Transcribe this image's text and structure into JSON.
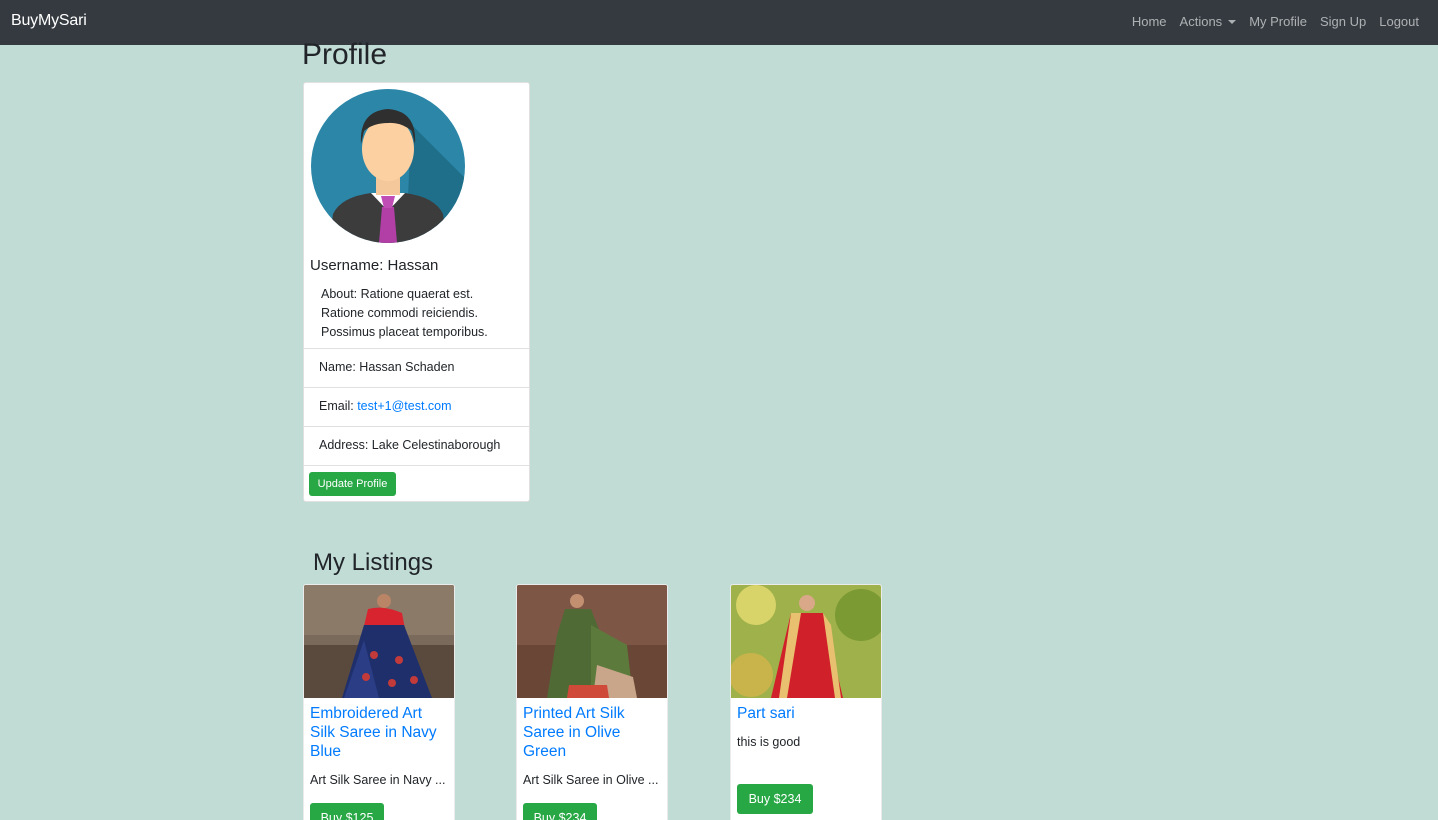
{
  "navbar": {
    "brand": "BuyMySari",
    "links": [
      "Home",
      "Actions",
      "My Profile",
      "Sign Up",
      "Logout"
    ]
  },
  "profile": {
    "title": "Profile",
    "username": "Username: Hassan",
    "about": "About: Ratione quaerat est. Ratione commodi reiciendis. Possimus placeat temporibus.",
    "name": "Name: Hassan Schaden",
    "email_label": "Email: ",
    "email": "test+1@test.com",
    "address": "Address: Lake Celestinaborough",
    "update_button": "Update Profile"
  },
  "listings": {
    "title": "My Listings",
    "items": [
      {
        "title": "Embroidered Art Silk Saree in Navy Blue",
        "desc": "Art Silk Saree in Navy ...",
        "button": "Buy $125"
      },
      {
        "title": "Printed Art Silk Saree in Olive Green",
        "desc": "Art Silk Saree in Olive ...",
        "button": "Buy $234"
      },
      {
        "title": "Part sari",
        "desc": "this is good",
        "button": "Buy $234"
      }
    ]
  },
  "colors": {
    "navbar": "#343a40",
    "background": "#c1dcd5",
    "success": "#28a745",
    "link": "#007bff"
  }
}
